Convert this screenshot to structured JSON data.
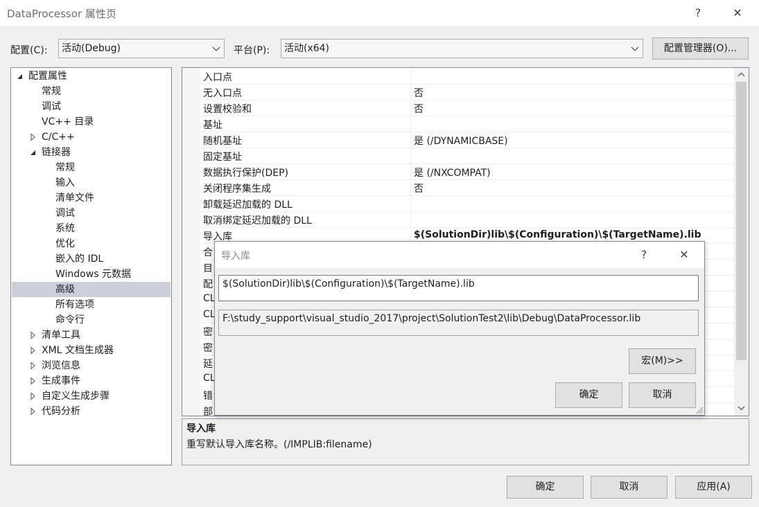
{
  "window": {
    "title": "DataProcessor 属性页",
    "help_label": "?",
    "close_label": "✕"
  },
  "config": {
    "label": "配置(C):",
    "value": "活动(Debug)",
    "platform_label": "平台(P):",
    "platform_value": "活动(x64)",
    "manager_button": "配置管理器(O)..."
  },
  "tree": [
    {
      "label": "配置属性",
      "expander": "expanded"
    },
    {
      "label": "常规",
      "expander": "none"
    },
    {
      "label": "调试",
      "expander": "none"
    },
    {
      "label": "VC++ 目录",
      "expander": "none"
    },
    {
      "label": "C/C++",
      "expander": "collapsed"
    },
    {
      "label": "链接器",
      "expander": "expanded"
    },
    {
      "label": "常规",
      "expander": "none"
    },
    {
      "label": "输入",
      "expander": "none"
    },
    {
      "label": "清单文件",
      "expander": "none"
    },
    {
      "label": "调试",
      "expander": "none"
    },
    {
      "label": "系统",
      "expander": "none"
    },
    {
      "label": "优化",
      "expander": "none"
    },
    {
      "label": "嵌入的 IDL",
      "expander": "none"
    },
    {
      "label": "Windows 元数据",
      "expander": "none"
    },
    {
      "label": "高级",
      "expander": "none",
      "selected": true
    },
    {
      "label": "所有选项",
      "expander": "none"
    },
    {
      "label": "命令行",
      "expander": "none"
    },
    {
      "label": "清单工具",
      "expander": "collapsed"
    },
    {
      "label": "XML 文档生成器",
      "expander": "collapsed"
    },
    {
      "label": "浏览信息",
      "expander": "collapsed"
    },
    {
      "label": "生成事件",
      "expander": "collapsed"
    },
    {
      "label": "自定义生成步骤",
      "expander": "collapsed"
    },
    {
      "label": "代码分析",
      "expander": "collapsed"
    }
  ],
  "grid": [
    {
      "name": "入口点",
      "value": ""
    },
    {
      "name": "无入口点",
      "value": "否"
    },
    {
      "name": "设置校验和",
      "value": "否"
    },
    {
      "name": "基址",
      "value": ""
    },
    {
      "name": "随机基址",
      "value": "是 (/DYNAMICBASE)"
    },
    {
      "name": "固定基址",
      "value": ""
    },
    {
      "name": "数据执行保护(DEP)",
      "value": "是 (/NXCOMPAT)"
    },
    {
      "name": "关闭程序集生成",
      "value": "否"
    },
    {
      "name": "卸载延迟加载的 DLL",
      "value": ""
    },
    {
      "name": "取消绑定延迟加载的 DLL",
      "value": ""
    },
    {
      "name": "导入库",
      "value": "$(SolutionDir)lib\\$(Configuration)\\$(TargetName).lib",
      "bold": true
    },
    {
      "name": "合",
      "value": ""
    },
    {
      "name": "目",
      "value": ""
    },
    {
      "name": "配",
      "value": ""
    },
    {
      "name": "CL",
      "value": ""
    },
    {
      "name": "CL",
      "value": ""
    },
    {
      "name": "密",
      "value": ""
    },
    {
      "name": "密",
      "value": ""
    },
    {
      "name": "延",
      "value": ""
    },
    {
      "name": "CL",
      "value": ""
    },
    {
      "name": "错",
      "value": ""
    },
    {
      "name": "部",
      "value": ""
    }
  ],
  "description": {
    "title": "导入库",
    "text": "重写默认导入库名称。(/IMPLIB:filename)"
  },
  "dialog": {
    "title": "导入库",
    "help_label": "?",
    "close_label": "✕",
    "input_value": "$(SolutionDir)lib\\$(Configuration)\\$(TargetName).lib",
    "evaluated_value": "F:\\study_support\\visual_studio_2017\\project\\SolutionTest2\\lib\\Debug\\DataProcessor.lib",
    "macros_button": "宏(M)>>",
    "ok_button": "确定",
    "cancel_button": "取消"
  },
  "footer": {
    "ok": "确定",
    "cancel": "取消",
    "apply": "应用(A)"
  },
  "colors": {
    "selection": "#cccedb",
    "dialog_border": "#8a8a8a",
    "window_bg": "#f0f0f0"
  }
}
